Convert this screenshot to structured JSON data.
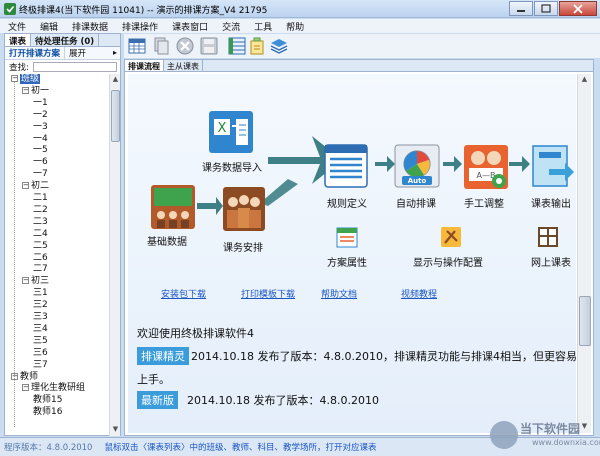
{
  "window": {
    "title": "终极排课4(当下软件园  11041) -- 演示的排课方案_V4  21795"
  },
  "menu": [
    "文件",
    "编辑",
    "排课数据",
    "排课操作",
    "课表窗口",
    "交流",
    "工具",
    "帮助"
  ],
  "left_panel": {
    "tabs": [
      "课表",
      "待处理任务 (0)"
    ],
    "open_plan": "打开排课方案",
    "expand": "展开",
    "search_label": "查找:",
    "tree": {
      "root": "班级",
      "groups": [
        {
          "name": "初一",
          "children": [
            "一1",
            "一2",
            "一3",
            "一4",
            "一5",
            "一6",
            "一7"
          ]
        },
        {
          "name": "初二",
          "children": [
            "二1",
            "二2",
            "二3",
            "二4",
            "二5",
            "二6",
            "二7"
          ]
        },
        {
          "name": "初三",
          "children": [
            "三1",
            "三2",
            "三3",
            "三4",
            "三5",
            "三6",
            "三7"
          ]
        }
      ],
      "teachers_root": "教师",
      "teacher_group": "理化生教研组",
      "teachers": [
        "教师15",
        "教师16"
      ]
    }
  },
  "toolbar": {
    "icons": [
      "schedule-grid-icon",
      "copy-icon",
      "cancel-icon",
      "save-icon",
      "table-icon",
      "export-icon",
      "layers-icon"
    ]
  },
  "main": {
    "tabs": [
      "排课流程",
      "主从课表"
    ],
    "flow": {
      "basic_data": "基础数据",
      "course_arrange": "课务安排",
      "course_import": "课务数据导入",
      "rule_define": "规则定义",
      "auto_schedule": "自动排课",
      "manual_adjust": "手工调整",
      "output": "课表输出",
      "plan_props": "方案属性",
      "display_config": "显示与操作配置",
      "online_table": "网上课表",
      "auto_badge": "Auto"
    },
    "links": [
      "安装包下载",
      "打印模板下载",
      "帮助文档",
      "视频教程"
    ],
    "welcome": "欢迎使用终极排课软件4",
    "news": [
      {
        "badge": "排课精灵",
        "text": "2014.10.18 发布了版本：4.8.0.2010，排课精灵功能与排课4相当，但更容易",
        "cont": "上手。"
      },
      {
        "badge": "最新版",
        "text": "2014.10.18 发布了版本：4.8.0.2010"
      }
    ]
  },
  "status": {
    "version": "程序版本：4.8.0.2010",
    "hint": "鼠标双击〈课表列表〉中的班级、教师、科目、教学场所，打开对应课表"
  },
  "watermark": {
    "main": "当下软件园",
    "sub": "www.downxia.com"
  },
  "colors": {
    "accent": "#3b9cdc",
    "link": "#1a56c6",
    "arrow": "#3f7f86"
  }
}
